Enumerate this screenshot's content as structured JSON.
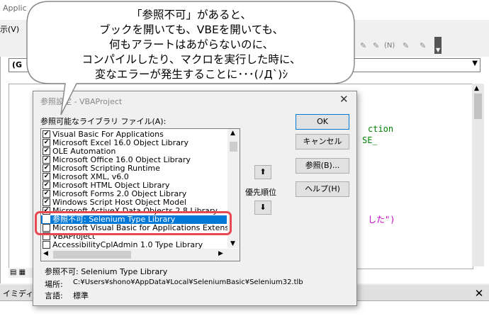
{
  "background": {
    "window_title": "Applic",
    "menu_view": "示(V)",
    "toolbar_n": "(N)",
    "proc_combo_value": "(G",
    "code_lines": [
      "ction",
      "SE_",
      "した\")"
    ],
    "immediate_title": "イミディエ",
    "close_glyph": "✕"
  },
  "callout": {
    "lines": [
      "「参照不可」があると、",
      "ブックを開いても、VBEを開いても、",
      "何もアラートはあがらないのに、",
      "コンパイルしたり、マクロを実行した時に、",
      "変なエラーが発生することに･･･(ﾉД`)ｼ"
    ]
  },
  "dialog": {
    "title": "参照設定 - VBAProject",
    "close_glyph": "✕",
    "list_label": "参照可能なライブラリ ファイル(A):",
    "items": [
      {
        "label": "Visual Basic For Applications",
        "checked": true,
        "selected": false
      },
      {
        "label": "Microsoft Excel 16.0 Object Library",
        "checked": true,
        "selected": false
      },
      {
        "label": "OLE Automation",
        "checked": true,
        "selected": false
      },
      {
        "label": "Microsoft Office 16.0 Object Library",
        "checked": true,
        "selected": false
      },
      {
        "label": "Microsoft Scripting Runtime",
        "checked": true,
        "selected": false
      },
      {
        "label": "Microsoft XML, v6.0",
        "checked": true,
        "selected": false
      },
      {
        "label": "Microsoft HTML Object Library",
        "checked": true,
        "selected": false
      },
      {
        "label": "Microsoft Forms 2.0 Object Library",
        "checked": true,
        "selected": false
      },
      {
        "label": "Windows Script Host Object Model",
        "checked": true,
        "selected": false
      },
      {
        "label": "Microsoft ActiveX Data Objects 2.8 Library",
        "checked": true,
        "selected": false
      },
      {
        "label": "参照不可: Selenium Type Library",
        "checked": true,
        "selected": true
      },
      {
        "label": "Microsoft Visual Basic for Applications Extensil",
        "checked": false,
        "selected": false
      },
      {
        "label": "VBAProject",
        "checked": false,
        "selected": false
      },
      {
        "label": "AccessibilityCplAdmin 1.0 Type Library",
        "checked": false,
        "selected": false
      }
    ],
    "buttons": {
      "ok": "OK",
      "cancel": "キャンセル",
      "browse": "参照(B)...",
      "help": "ヘルプ(H)",
      "up": "⬆",
      "down": "⬇"
    },
    "priority_label": "優先順位",
    "info": {
      "title": "参照不可: Selenium Type Library",
      "location_label": "場所:",
      "location_value": "C:¥Users¥shono¥AppData¥Local¥SeleniumBasic¥Selenium32.tlb",
      "language_label": "言語:",
      "language_value": "標準"
    }
  },
  "colors": {
    "selection": "#0078d7",
    "highlight_outline": "#e8484f",
    "code_green": "#008000",
    "code_magenta": "#c000c0"
  }
}
